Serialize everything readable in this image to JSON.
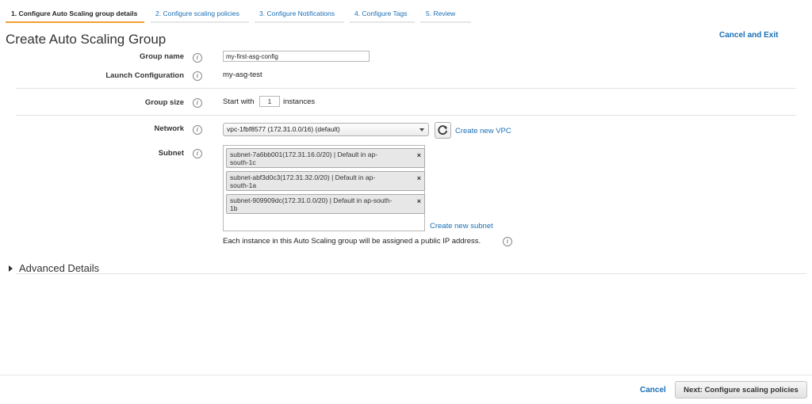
{
  "tabs": [
    {
      "label": "1. Configure Auto Scaling group details",
      "active": true
    },
    {
      "label": "2. Configure scaling policies",
      "active": false
    },
    {
      "label": "3. Configure Notifications",
      "active": false
    },
    {
      "label": "4. Configure Tags",
      "active": false
    },
    {
      "label": "5. Review",
      "active": false
    }
  ],
  "page_title": "Create Auto Scaling Group",
  "cancel_exit_label": "Cancel and Exit",
  "form": {
    "group_name": {
      "label": "Group name",
      "value": "my-first-asg-config"
    },
    "launch_configuration": {
      "label": "Launch Configuration",
      "value": "my-asg-test"
    },
    "group_size": {
      "label": "Group size",
      "prefix": "Start with",
      "value": "1",
      "suffix": "instances"
    },
    "network": {
      "label": "Network",
      "selected": "vpc-1fbf8577 (172.31.0.0/16) (default)",
      "create_link": "Create new VPC"
    },
    "subnet": {
      "label": "Subnet",
      "chips": [
        {
          "line1": "subnet-7a6bb001(172.31.16.0/20) | Default in ap-",
          "line2": "south-1c"
        },
        {
          "line1": "subnet-abf3d0c3(172.31.32.0/20) | Default in ap-",
          "line2": "south-1a"
        },
        {
          "line1": "subnet-909909dc(172.31.0.0/20) | Default in ap-south-",
          "line2": "1b"
        }
      ],
      "create_link": "Create new subnet",
      "note": "Each instance in this Auto Scaling group will be assigned a public IP address."
    }
  },
  "info_icon_glyph": "i",
  "remove_glyph": "×",
  "advanced_details_label": "Advanced Details",
  "footer": {
    "cancel_label": "Cancel",
    "next_label": "Next: Configure scaling policies"
  },
  "colors": {
    "accent_link": "#1a6fb5",
    "active_tab_underline": "#f0a033"
  }
}
